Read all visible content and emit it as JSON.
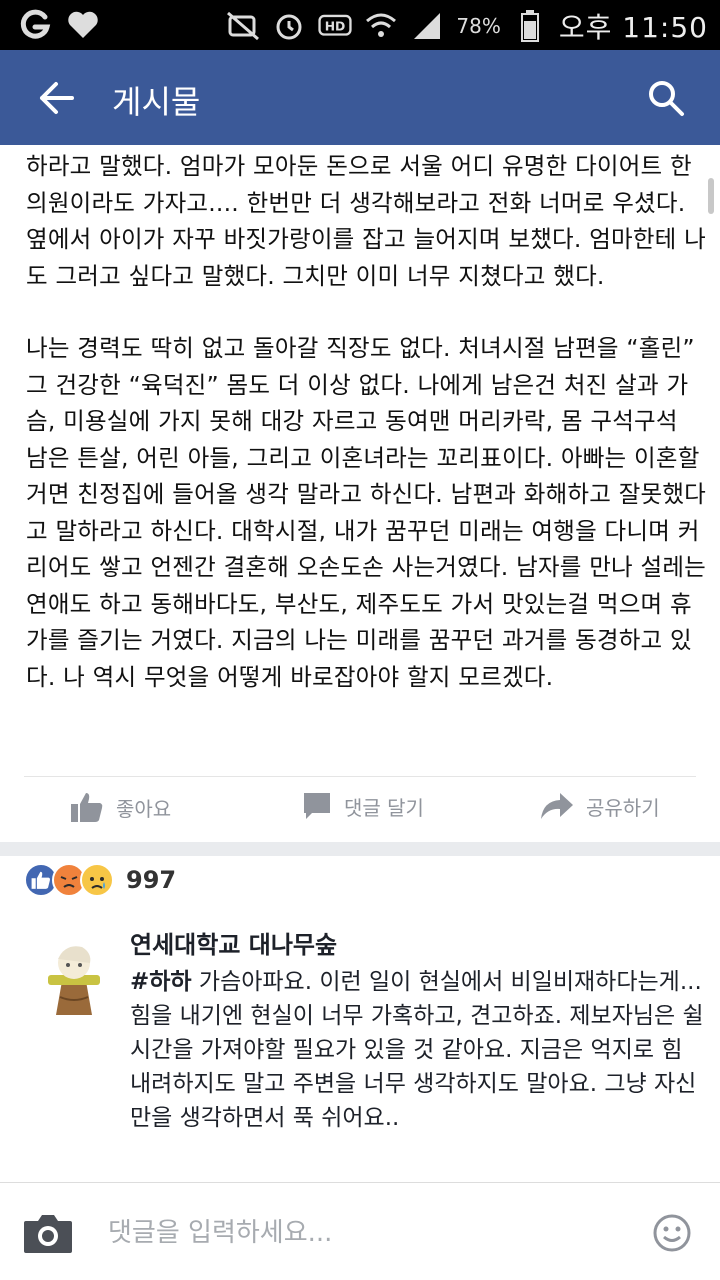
{
  "status_bar": {
    "battery": "78%",
    "time": "오후 11:50"
  },
  "app_bar": {
    "title": "게시물"
  },
  "post": {
    "paragraph1": "하라고 말했다. 엄마가 모아둔 돈으로 서울 어디 유명한 다이어트 한의원이라도 가자고.... 한번만 더 생각해보라고 전화 너머로 우셨다. 옆에서 아이가 자꾸 바짓가랑이를 잡고 늘어지며 보챘다. 엄마한테 나도 그러고 싶다고 말했다. 그치만 이미 너무 지쳤다고 했다.",
    "paragraph2": "나는 경력도 딱히 없고 돌아갈 직장도 없다. 처녀시절 남편을 “홀린” 그 건강한 “육덕진” 몸도 더 이상 없다. 나에게 남은건 처진 살과 가슴, 미용실에 가지 못해 대강 자르고 동여맨 머리카락, 몸 구석구석 남은 튼살, 어린 아들, 그리고 이혼녀라는 꼬리표이다. 아빠는 이혼할거면 친정집에 들어올 생각 말라고 하신다. 남편과 화해하고 잘못했다고 말하라고 하신다. 대학시절, 내가 꿈꾸던 미래는 여행을 다니며 커리어도 쌓고 언젠간 결혼해 오손도손 사는거였다. 남자를 만나 설레는 연애도 하고 동해바다도, 부산도, 제주도도 가서 맛있는걸 먹으며 휴가를 즐기는 거였다. 지금의 나는 미래를 꿈꾸던 과거를 동경하고 있다. 나 역시 무엇을 어떻게 바로잡아야 할지 모르겠다."
  },
  "actions": {
    "like": "좋아요",
    "comment": "댓글 달기",
    "share": "공유하기"
  },
  "reactions": {
    "count": "997"
  },
  "comment": {
    "author": "연세대학교 대나무숲",
    "hashtag": "#하하",
    "text": " 가슴아파요. 이런 일이 현실에서 비일비재하다는게... 힘을 내기엔 현실이 너무 가혹하고, 견고하죠. 제보자님은 쉴 시간을 가져야할 필요가 있을 것 같아요. 지금은 억지로 힘 내려하지도 말고 주변을 너무 생각하지도 말아요. 그냥 자신만을 생각하면서 푹 쉬어요.."
  },
  "input": {
    "placeholder": "댓글을 입력하세요..."
  },
  "colors": {
    "brand": "#3b5998",
    "like_blue": "#4267b2",
    "angry": "#f0823c",
    "sad": "#f7c646"
  }
}
